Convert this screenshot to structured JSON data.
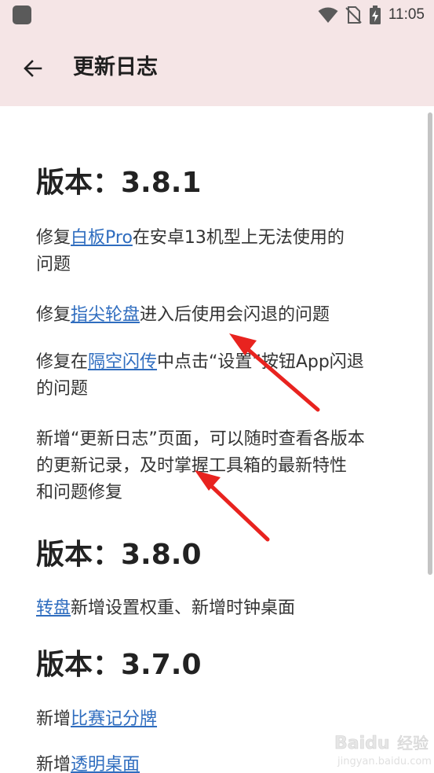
{
  "status_bar": {
    "time": "11:05",
    "icons": [
      "app-icon",
      "wifi-icon",
      "no-sim-icon",
      "battery-charging-icon"
    ]
  },
  "app_bar": {
    "back_icon": "arrow-left-icon",
    "title": "更新日志"
  },
  "sections": [
    {
      "heading": "版本：3.8.1",
      "entries": [
        {
          "lines": [
            [
              {
                "t": "修复"
              },
              {
                "t": "白板Pro",
                "link": true
              },
              {
                "t": "在安卓13机型上无法使用的"
              }
            ],
            [
              {
                "t": "问题"
              }
            ]
          ]
        },
        {
          "lines": [
            [
              {
                "t": "修复"
              },
              {
                "t": "指尖轮盘",
                "link": true
              },
              {
                "t": "进入后使用会闪退的问题"
              }
            ]
          ]
        },
        {
          "lines": [
            [
              {
                "t": "修复在"
              },
              {
                "t": "隔空闪传",
                "link": true
              },
              {
                "t": "中点击“设置”按钮App闪退"
              }
            ],
            [
              {
                "t": "的问题"
              }
            ]
          ]
        },
        {
          "lines": [
            [
              {
                "t": "新增“更新日志”页面，可以随时查看各版本"
              }
            ],
            [
              {
                "t": "的更新记录，及时掌握工具箱的最新特性"
              }
            ],
            [
              {
                "t": "和问题修复"
              }
            ]
          ]
        }
      ]
    },
    {
      "heading": "版本：3.8.0",
      "entries": [
        {
          "lines": [
            [
              {
                "t": "转盘",
                "link": true
              },
              {
                "t": "新增设置权重、新增时钟桌面"
              }
            ]
          ]
        }
      ]
    },
    {
      "heading": "版本：3.7.0",
      "entries": [
        {
          "lines": [
            [
              {
                "t": "新增"
              },
              {
                "t": "比赛记分牌",
                "link": true
              }
            ]
          ]
        },
        {
          "lines": [
            [
              {
                "t": "新增"
              },
              {
                "t": "透明桌面",
                "link": true
              }
            ]
          ]
        }
      ]
    }
  ],
  "watermark": {
    "brand": "Baidu",
    "suffix": "经验",
    "url": "jingyan.baidu.com"
  },
  "colors": {
    "app_bar_bg": "#f5e5e6",
    "link": "#2f6dbf",
    "arrow": "#e8231f"
  }
}
